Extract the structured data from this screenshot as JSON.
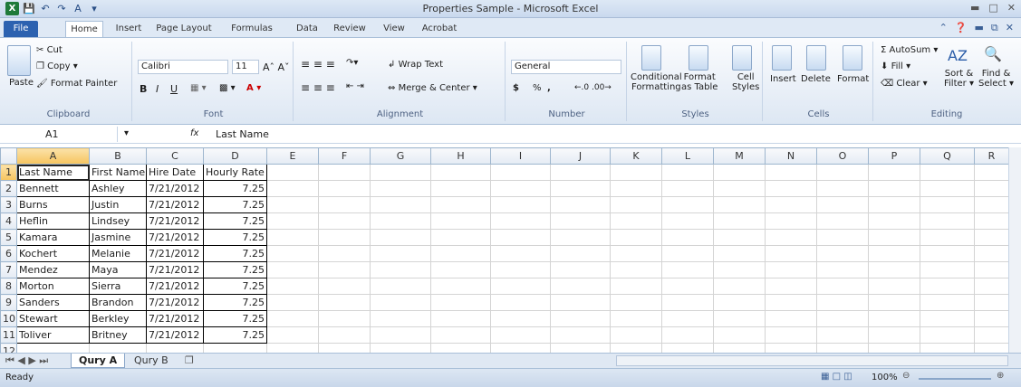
{
  "window": {
    "title": "Properties Sample - Microsoft Excel",
    "app_icon": "X"
  },
  "tabs": [
    "File",
    "Home",
    "Insert",
    "Page Layout",
    "Formulas",
    "Data",
    "Review",
    "View",
    "Acrobat"
  ],
  "ribbon": {
    "clipboard": {
      "paste": "Paste",
      "cut": "Cut",
      "copy": "Copy",
      "format_painter": "Format Painter",
      "label": "Clipboard"
    },
    "font": {
      "name": "Calibri",
      "size": "11",
      "label": "Font",
      "bold": "B",
      "italic": "I",
      "underline": "U"
    },
    "alignment": {
      "wrap": "Wrap Text",
      "merge": "Merge & Center",
      "label": "Alignment"
    },
    "number": {
      "format": "General",
      "currency": "$",
      "percent": "%",
      "comma": ",",
      "label": "Number"
    },
    "styles": {
      "conditional_line1": "Conditional",
      "conditional_line2": "Formatting",
      "format_table_line1": "Format",
      "format_table_line2": "as Table",
      "cell_styles_line1": "Cell",
      "cell_styles_line2": "Styles",
      "label": "Styles"
    },
    "cells": {
      "insert": "Insert",
      "delete": "Delete",
      "format": "Format",
      "label": "Cells"
    },
    "editing": {
      "autosum": "AutoSum",
      "fill": "Fill",
      "clear": "Clear",
      "sort_line1": "Sort &",
      "sort_line2": "Filter",
      "find_line1": "Find &",
      "find_line2": "Select",
      "label": "Editing"
    }
  },
  "formula_bar": {
    "name_box": "A1",
    "fx": "fx",
    "content": "Last Name"
  },
  "columns": [
    "A",
    "B",
    "C",
    "D",
    "E",
    "F",
    "G",
    "H",
    "I",
    "J",
    "K",
    "L",
    "M",
    "N",
    "O",
    "P",
    "Q",
    "R"
  ],
  "rows": [
    [
      "Last Name",
      "First Name",
      "Hire Date",
      "Hourly Rate"
    ],
    [
      "Bennett",
      "Ashley",
      "7/21/2012",
      "7.25"
    ],
    [
      "Burns",
      "Justin",
      "7/21/2012",
      "7.25"
    ],
    [
      "Heflin",
      "Lindsey",
      "7/21/2012",
      "7.25"
    ],
    [
      "Kamara",
      "Jasmine",
      "7/21/2012",
      "7.25"
    ],
    [
      "Kochert",
      "Melanie",
      "7/21/2012",
      "7.25"
    ],
    [
      "Mendez",
      "Maya",
      "7/21/2012",
      "7.25"
    ],
    [
      "Morton",
      "Sierra",
      "7/21/2012",
      "7.25"
    ],
    [
      "Sanders",
      "Brandon",
      "7/21/2012",
      "7.25"
    ],
    [
      "Stewart",
      "Berkley",
      "7/21/2012",
      "7.25"
    ],
    [
      "Toliver",
      "Britney",
      "7/21/2012",
      "7.25"
    ]
  ],
  "sheets": [
    "Qury A",
    "Qury B"
  ],
  "status": {
    "ready": "Ready",
    "zoom": "100%"
  }
}
